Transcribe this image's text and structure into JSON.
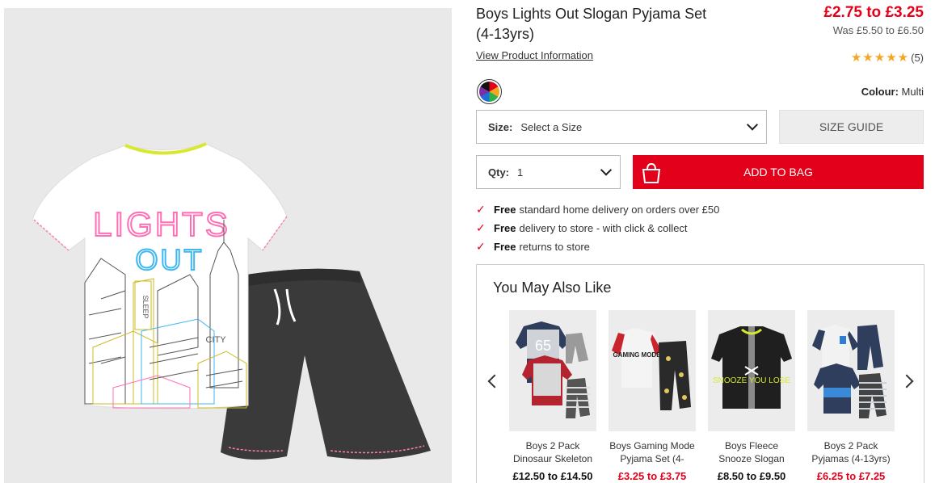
{
  "product": {
    "title": "Boys Lights Out Slogan Pyjama Set (4-13yrs)",
    "price": "£2.75 to £3.25",
    "was_price": "Was £5.50 to £6.50",
    "view_info_link": "View Product Information",
    "rating_count": "(5)",
    "stars": 5,
    "colour_label": "Colour:",
    "colour_value": "Multi",
    "tshirt_text_line1": "LIGHTS",
    "tshirt_text_line2": "OUT",
    "tshirt_small_text": "CITY",
    "tshirt_side_text": "SLEEP"
  },
  "size": {
    "label": "Size:",
    "value": "Select a Size"
  },
  "qty": {
    "label": "Qty:",
    "value": "1"
  },
  "buttons": {
    "size_guide": "SIZE GUIDE",
    "add_to_bag": "ADD TO BAG"
  },
  "perks": [
    {
      "bold": "Free",
      "text": "standard home delivery on orders over £50"
    },
    {
      "bold": "Free",
      "text": "delivery to store - with click & collect"
    },
    {
      "bold": "Free",
      "text": "returns to store"
    }
  ],
  "recommendations": {
    "heading": "You May Also Like",
    "items": [
      {
        "name": "Boys 2 Pack Dinosaur Skeleton",
        "price": "£12.50 to £14.50",
        "sale": false,
        "thumb_text": "65"
      },
      {
        "name": "Boys Gaming Mode Pyjama Set (4-",
        "price": "£3.25 to £3.75",
        "sale": true,
        "thumb_text": "GAMING MODE"
      },
      {
        "name": "Boys Fleece Snooze Slogan",
        "price": "£8.50 to £9.50",
        "sale": false,
        "thumb_text": "SNOOZE YOU LOSE"
      },
      {
        "name": "Boys 2 Pack Pyjamas (4-13yrs)",
        "price": "£6.25 to £7.25",
        "sale": true,
        "thumb_text": ""
      }
    ]
  },
  "colors": {
    "brand_red": "#e2001a",
    "star": "#f5a623",
    "neon_pink": "#ff6fb5",
    "neon_blue": "#3fb7f0"
  }
}
